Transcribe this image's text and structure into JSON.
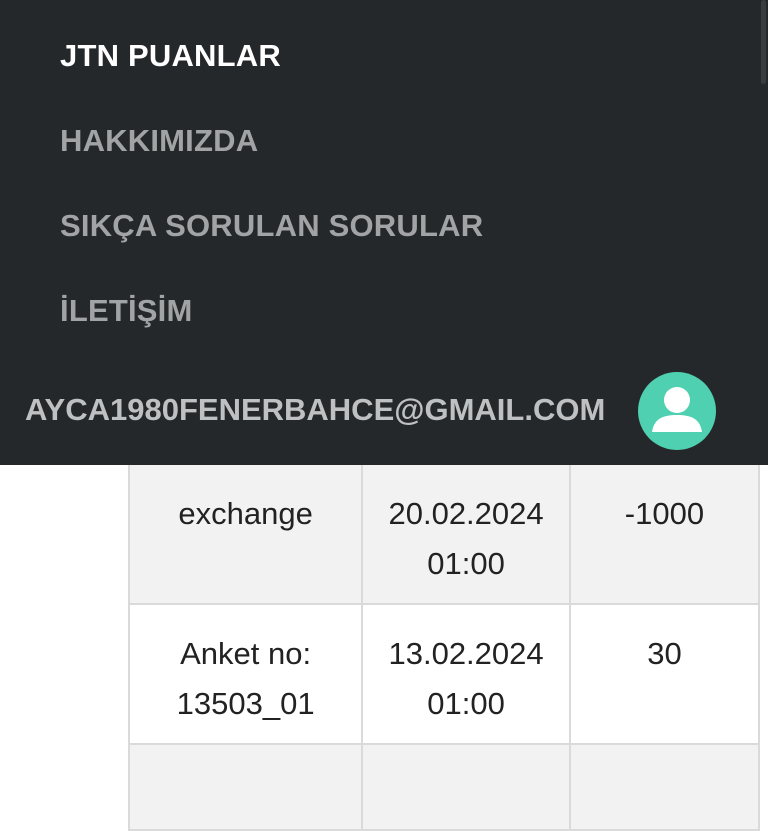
{
  "menu": {
    "items": [
      {
        "label": "JTN PUANLAR",
        "active": true
      },
      {
        "label": "HAKKIMIZDA",
        "active": false
      },
      {
        "label": "SIKÇA SORULAN SORULAR",
        "active": false
      },
      {
        "label": "İLETİŞİM",
        "active": false
      }
    ],
    "user_email": "AYCA1980FENERBAHCE@GMAIL.COM",
    "avatar_icon": "user-avatar-icon"
  },
  "table": {
    "rows": [
      {
        "description": [
          "exchange"
        ],
        "date": "20.02.2024",
        "time": "01:00",
        "points": "-1000"
      },
      {
        "description": [
          "Anket no:",
          "13503_01"
        ],
        "date": "13.02.2024",
        "time": "01:00",
        "points": "30"
      }
    ]
  },
  "colors": {
    "menu_bg": "#25282b",
    "avatar_bg": "#4fd0b1",
    "active_text": "#ffffff",
    "inactive_text": "#a2a3a5"
  }
}
